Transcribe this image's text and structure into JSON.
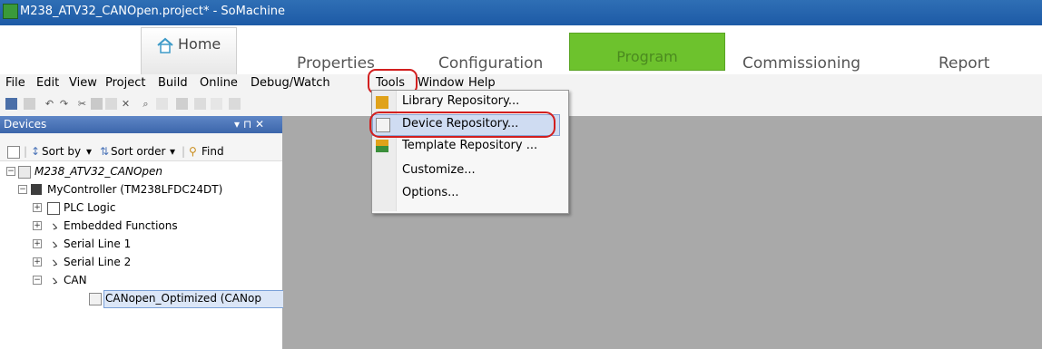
{
  "window": {
    "title": "M238_ATV32_CANOpen.project* - SoMachine"
  },
  "ribbon": {
    "tabs": [
      {
        "label": "Home"
      },
      {
        "label": "Properties"
      },
      {
        "label": "Configuration"
      },
      {
        "label": "Program"
      },
      {
        "label": "Commissioning"
      },
      {
        "label": "Report"
      }
    ],
    "active_tab_color": "#6dc22d"
  },
  "menubar": {
    "items": [
      "File",
      "Edit",
      "View",
      "Project",
      "Build",
      "Online",
      "Debug/Watch",
      "Tools",
      "Window",
      "Help"
    ],
    "highlighted": "Tools",
    "highlight_color": "#d21f1f"
  },
  "tools_menu": {
    "items": [
      {
        "label": "Library Repository...",
        "icon": "books-icon"
      },
      {
        "label": "Device Repository...",
        "icon": "device-icon",
        "highlighted": true
      },
      {
        "label": "Template Repository ...",
        "icon": "template-icon"
      },
      {
        "label": "Customize..."
      },
      {
        "label": "Options..."
      }
    ]
  },
  "devices": {
    "title": "Devices",
    "pane_controls": "▾ ⊓ ✕",
    "toolbar": {
      "sort_by": "Sort by",
      "sort_order": "Sort order",
      "find": "Find"
    },
    "tree": [
      {
        "label": "M238_ATV32_CANOpen",
        "level": 0,
        "italic": true
      },
      {
        "label": "MyController (TM238LFDC24DT)",
        "level": 1
      },
      {
        "label": "PLC Logic",
        "level": 2
      },
      {
        "label": "Embedded Functions",
        "level": 2
      },
      {
        "label": "Serial Line 1",
        "level": 2
      },
      {
        "label": "Serial Line 2",
        "level": 2
      },
      {
        "label": "CAN",
        "level": 2
      },
      {
        "label": "CANopen_Optimized (CANop",
        "level": 3,
        "selected": true
      }
    ]
  }
}
